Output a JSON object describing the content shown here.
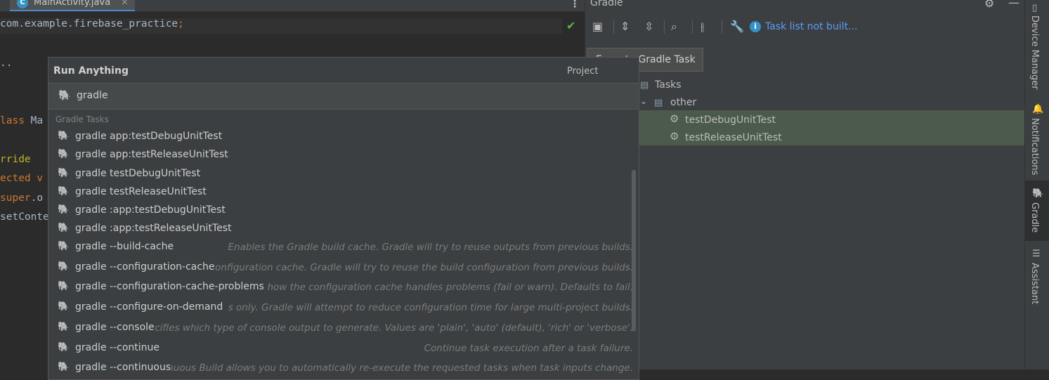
{
  "editor": {
    "tab_icon_letter": "C",
    "tab_label": "MainActivity.java",
    "tab_close": "×",
    "more_icon": "⋮",
    "package_text": "com.example.firebase_practice",
    "package_semicolon": ";",
    "ellipsis": "..",
    "class_kw": "lass",
    "class_name": " Ma",
    "override_text": "rride",
    "protected_text": "ected v",
    "super_kw": "super",
    "super_rest": ".o",
    "setcontent_text": "setConte",
    "check_icon": "✔"
  },
  "run_anything": {
    "title": "Run Anything",
    "project_label": "Project",
    "search_value": "gradle",
    "group_header": "Gradle Tasks",
    "items": [
      {
        "cmd": "gradle app:testDebugUnitTest",
        "desc": ""
      },
      {
        "cmd": "gradle app:testReleaseUnitTest",
        "desc": ""
      },
      {
        "cmd": "gradle testDebugUnitTest",
        "desc": ""
      },
      {
        "cmd": "gradle testReleaseUnitTest",
        "desc": ""
      },
      {
        "cmd": "gradle :app:testDebugUnitTest",
        "desc": ""
      },
      {
        "cmd": "gradle :app:testReleaseUnitTest",
        "desc": ""
      },
      {
        "cmd": "gradle --build-cache",
        "desc": "Enables the Gradle build cache. Gradle will try to reuse outputs from previous builds."
      },
      {
        "cmd": "gradle --configuration-cache",
        "desc": "onfiguration cache. Gradle will try to reuse the build configuration from previous builds."
      },
      {
        "cmd": "gradle --configuration-cache-problems",
        "desc": "how the configuration cache handles problems (fail or warn). Defaults to fail."
      },
      {
        "cmd": "gradle --configure-on-demand",
        "desc": "s only. Gradle will attempt to reduce configuration time for large multi-project builds."
      },
      {
        "cmd": "gradle --console",
        "desc": "ecifies which type of console output to generate. Values are 'plain', 'auto' (default), 'rich' or 'verbose'."
      },
      {
        "cmd": "gradle --continue",
        "desc": "Continue task execution after a task failure."
      },
      {
        "cmd": "gradle --continuous",
        "desc": "nuous Build allows you to automatically re-execute the requested tasks when task inputs change."
      }
    ]
  },
  "gradle_panel": {
    "title": "Gradle",
    "tasklist_link": "Task list not built...",
    "tooltip": "Execute Gradle Task",
    "tree": {
      "tasks_label": "Tasks",
      "other_label": "other",
      "task1": "testDebugUnitTest",
      "task2": "testReleaseUnitTest"
    }
  },
  "right_strip": {
    "device_manager": "Device Manager",
    "notifications": "Notifications",
    "gradle": "Gradle",
    "assistant": "Assistant"
  },
  "colors": {
    "accent_blue": "#589df6",
    "keyword_orange": "#cc7832",
    "check_green": "#5fb13d",
    "selection_green": "#4b5a4b"
  }
}
